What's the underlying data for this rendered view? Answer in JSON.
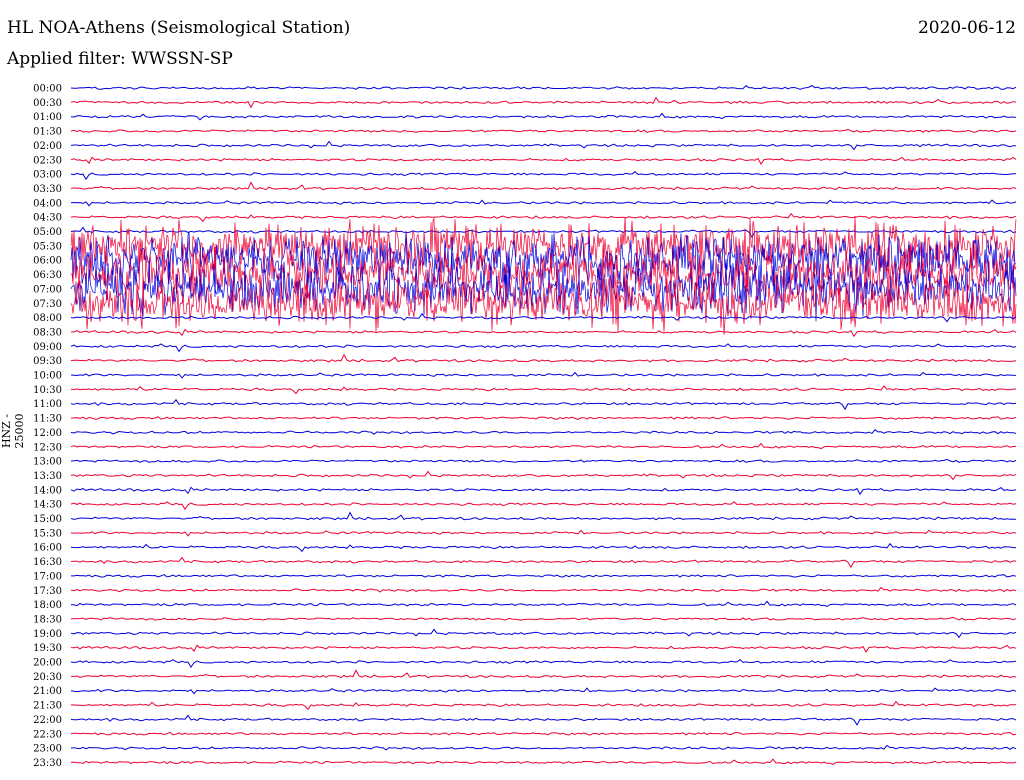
{
  "header": {
    "station": "HL NOA-Athens (Seismological Station)",
    "date": "2020-06-12",
    "filter": "Applied filter: WWSSN-SP",
    "channel_label": "HNZ - 25000"
  },
  "chart_data": {
    "type": "line",
    "title": "HL NOA-Athens (Seismological Station)",
    "subtitle": "Applied filter: WWSSN-SP",
    "ylabel": "HNZ - 25000",
    "xlabel": "",
    "y_tick_labels": [
      "00:00",
      "00:30",
      "01:00",
      "01:30",
      "02:00",
      "02:30",
      "03:00",
      "03:30",
      "04:00",
      "04:30",
      "05:00",
      "05:30",
      "06:00",
      "06:30",
      "07:00",
      "07:30",
      "08:00",
      "08:30",
      "09:00",
      "09:30",
      "10:00",
      "10:30",
      "11:00",
      "11:30",
      "12:00",
      "12:30",
      "13:00",
      "13:30",
      "14:00",
      "14:30",
      "15:00",
      "15:30",
      "16:00",
      "16:30",
      "17:00",
      "17:30",
      "18:00",
      "18:30",
      "19:00",
      "19:30",
      "20:00",
      "20:30",
      "21:00",
      "21:30",
      "22:00",
      "22:30",
      "23:00",
      "23:30"
    ],
    "series_colors": [
      "#0000dd",
      "#ee0033"
    ],
    "traces_per_row_minutes": 30,
    "grid": false,
    "notes_high_activity_rows": [
      "05:30",
      "06:00",
      "06:30",
      "07:00",
      "07:30"
    ]
  }
}
